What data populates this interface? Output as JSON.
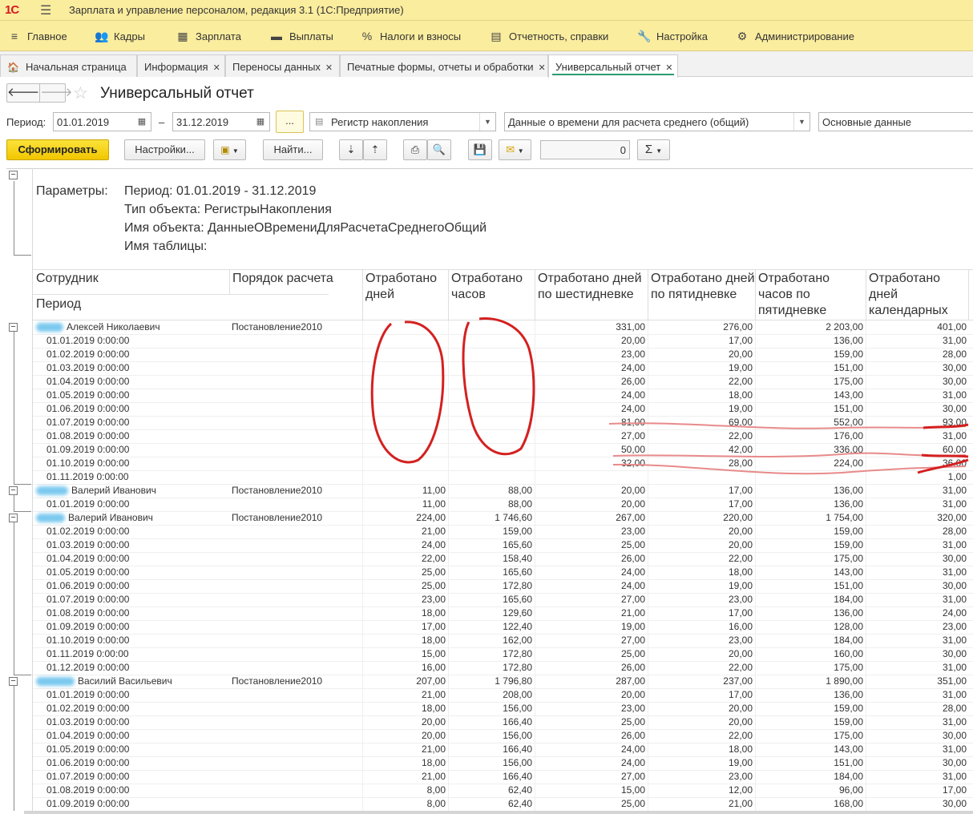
{
  "app": {
    "logo": "1С",
    "title": "Зарплата и управление персоналом, редакция 3.1  (1С:Предприятие)"
  },
  "menu": [
    {
      "label": "Главное",
      "icon": "≡",
      "name": "menu-main"
    },
    {
      "label": "Кадры",
      "icon": "👥",
      "name": "menu-staff"
    },
    {
      "label": "Зарплата",
      "icon": "▦",
      "name": "menu-salary"
    },
    {
      "label": "Выплаты",
      "icon": "▬",
      "name": "menu-payments"
    },
    {
      "label": "Налоги и взносы",
      "icon": "%",
      "name": "menu-taxes"
    },
    {
      "label": "Отчетность, справки",
      "icon": "▤",
      "name": "menu-reports"
    },
    {
      "label": "Настройка",
      "icon": "🔧",
      "name": "menu-settings"
    },
    {
      "label": "Администрирование",
      "icon": "⚙",
      "name": "menu-admin"
    }
  ],
  "tabs": [
    {
      "label": "Начальная страница",
      "home": true
    },
    {
      "label": "Информация"
    },
    {
      "label": "Переносы данных"
    },
    {
      "label": "Печатные формы, отчеты и обработки"
    },
    {
      "label": "Универсальный отчет",
      "active": true
    }
  ],
  "form": {
    "title": "Универсальный отчет",
    "period_label": "Период:",
    "date_from": "01.01.2019",
    "dash": "–",
    "date_to": "31.12.2019",
    "ellipsis": "...",
    "object_type": "Регистр накопления",
    "object_name": "Данные о времени для расчета среднего (общий)",
    "table": "Основные данные",
    "generate_btn": "Сформировать",
    "settings_btn": "Настройки...",
    "find_btn": "Найти...",
    "sum_value": "0",
    "sigma": "Σ"
  },
  "params": {
    "label": "Параметры:",
    "period": "Период: 01.01.2019 - 31.12.2019",
    "object_type": "Тип объекта: РегистрыНакопления",
    "object_name": "Имя объекта: ДанныеОВремениДляРасчетаСреднегоОбщий",
    "table_name": "Имя таблицы:"
  },
  "headers": {
    "employee": "Сотрудник",
    "period": "Период",
    "calc_order": "Порядок расчета",
    "days": "Отработано дней",
    "hours": "Отработано часов",
    "days6": "Отработано дней по шестидневке",
    "days5": "Отработано дней по пятидневке",
    "hours5": "Отработано часов по пятидневке",
    "calendar": "Отработано дней календарных"
  },
  "rows": [
    {
      "type": "group",
      "name": "Алексей Николаевич",
      "order": "Постановление2010",
      "days": "",
      "hours": "",
      "d6": "331,00",
      "d5": "276,00",
      "h5": "2 203,00",
      "cal": "401,00"
    },
    {
      "type": "detail",
      "period": "01.01.2019 0:00:00",
      "days": "",
      "hours": "",
      "d6": "20,00",
      "d5": "17,00",
      "h5": "136,00",
      "cal": "31,00"
    },
    {
      "type": "detail",
      "period": "01.02.2019 0:00:00",
      "days": "",
      "hours": "",
      "d6": "23,00",
      "d5": "20,00",
      "h5": "159,00",
      "cal": "28,00"
    },
    {
      "type": "detail",
      "period": "01.03.2019 0:00:00",
      "days": "",
      "hours": "",
      "d6": "24,00",
      "d5": "19,00",
      "h5": "151,00",
      "cal": "30,00"
    },
    {
      "type": "detail",
      "period": "01.04.2019 0:00:00",
      "days": "",
      "hours": "",
      "d6": "26,00",
      "d5": "22,00",
      "h5": "175,00",
      "cal": "30,00"
    },
    {
      "type": "detail",
      "period": "01.05.2019 0:00:00",
      "days": "",
      "hours": "",
      "d6": "24,00",
      "d5": "18,00",
      "h5": "143,00",
      "cal": "31,00"
    },
    {
      "type": "detail",
      "period": "01.06.2019 0:00:00",
      "days": "",
      "hours": "",
      "d6": "24,00",
      "d5": "19,00",
      "h5": "151,00",
      "cal": "30,00"
    },
    {
      "type": "detail",
      "period": "01.07.2019 0:00:00",
      "days": "",
      "hours": "",
      "d6": "81,00",
      "d5": "69,00",
      "h5": "552,00",
      "cal": "93,00"
    },
    {
      "type": "detail",
      "period": "01.08.2019 0:00:00",
      "days": "",
      "hours": "",
      "d6": "27,00",
      "d5": "22,00",
      "h5": "176,00",
      "cal": "31,00"
    },
    {
      "type": "detail",
      "period": "01.09.2019 0:00:00",
      "days": "",
      "hours": "",
      "d6": "50,00",
      "d5": "42,00",
      "h5": "336,00",
      "cal": "60,00"
    },
    {
      "type": "detail",
      "period": "01.10.2019 0:00:00",
      "days": "",
      "hours": "",
      "d6": "32,00",
      "d5": "28,00",
      "h5": "224,00",
      "cal": "36,00"
    },
    {
      "type": "detail",
      "period": "01.11.2019 0:00:00",
      "days": "",
      "hours": "",
      "d6": "",
      "d5": "",
      "h5": "",
      "cal": "1,00"
    },
    {
      "type": "group",
      "name": "Валерий Иванович",
      "order": "Постановление2010",
      "days": "11,00",
      "hours": "88,00",
      "d6": "20,00",
      "d5": "17,00",
      "h5": "136,00",
      "cal": "31,00"
    },
    {
      "type": "detail",
      "period": "01.01.2019 0:00:00",
      "days": "11,00",
      "hours": "88,00",
      "d6": "20,00",
      "d5": "17,00",
      "h5": "136,00",
      "cal": "31,00"
    },
    {
      "type": "group",
      "name": "Валерий Иванович",
      "order": "Постановление2010",
      "days": "224,00",
      "hours": "1 746,60",
      "d6": "267,00",
      "d5": "220,00",
      "h5": "1 754,00",
      "cal": "320,00"
    },
    {
      "type": "detail",
      "period": "01.02.2019 0:00:00",
      "days": "21,00",
      "hours": "159,00",
      "d6": "23,00",
      "d5": "20,00",
      "h5": "159,00",
      "cal": "28,00"
    },
    {
      "type": "detail",
      "period": "01.03.2019 0:00:00",
      "days": "24,00",
      "hours": "165,60",
      "d6": "25,00",
      "d5": "20,00",
      "h5": "159,00",
      "cal": "31,00"
    },
    {
      "type": "detail",
      "period": "01.04.2019 0:00:00",
      "days": "22,00",
      "hours": "158,40",
      "d6": "26,00",
      "d5": "22,00",
      "h5": "175,00",
      "cal": "30,00"
    },
    {
      "type": "detail",
      "period": "01.05.2019 0:00:00",
      "days": "25,00",
      "hours": "165,60",
      "d6": "24,00",
      "d5": "18,00",
      "h5": "143,00",
      "cal": "31,00"
    },
    {
      "type": "detail",
      "period": "01.06.2019 0:00:00",
      "days": "25,00",
      "hours": "172,80",
      "d6": "24,00",
      "d5": "19,00",
      "h5": "151,00",
      "cal": "30,00"
    },
    {
      "type": "detail",
      "period": "01.07.2019 0:00:00",
      "days": "23,00",
      "hours": "165,60",
      "d6": "27,00",
      "d5": "23,00",
      "h5": "184,00",
      "cal": "31,00"
    },
    {
      "type": "detail",
      "period": "01.08.2019 0:00:00",
      "days": "18,00",
      "hours": "129,60",
      "d6": "21,00",
      "d5": "17,00",
      "h5": "136,00",
      "cal": "24,00"
    },
    {
      "type": "detail",
      "period": "01.09.2019 0:00:00",
      "days": "17,00",
      "hours": "122,40",
      "d6": "19,00",
      "d5": "16,00",
      "h5": "128,00",
      "cal": "23,00"
    },
    {
      "type": "detail",
      "period": "01.10.2019 0:00:00",
      "days": "18,00",
      "hours": "162,00",
      "d6": "27,00",
      "d5": "23,00",
      "h5": "184,00",
      "cal": "31,00"
    },
    {
      "type": "detail",
      "period": "01.11.2019 0:00:00",
      "days": "15,00",
      "hours": "172,80",
      "d6": "25,00",
      "d5": "20,00",
      "h5": "160,00",
      "cal": "30,00"
    },
    {
      "type": "detail",
      "period": "01.12.2019 0:00:00",
      "days": "16,00",
      "hours": "172,80",
      "d6": "26,00",
      "d5": "22,00",
      "h5": "175,00",
      "cal": "31,00"
    },
    {
      "type": "group",
      "name": "Василий Васильевич",
      "order": "Постановление2010",
      "days": "207,00",
      "hours": "1 796,80",
      "d6": "287,00",
      "d5": "237,00",
      "h5": "1 890,00",
      "cal": "351,00"
    },
    {
      "type": "detail",
      "period": "01.01.2019 0:00:00",
      "days": "21,00",
      "hours": "208,00",
      "d6": "20,00",
      "d5": "17,00",
      "h5": "136,00",
      "cal": "31,00"
    },
    {
      "type": "detail",
      "period": "01.02.2019 0:00:00",
      "days": "18,00",
      "hours": "156,00",
      "d6": "23,00",
      "d5": "20,00",
      "h5": "159,00",
      "cal": "28,00"
    },
    {
      "type": "detail",
      "period": "01.03.2019 0:00:00",
      "days": "20,00",
      "hours": "166,40",
      "d6": "25,00",
      "d5": "20,00",
      "h5": "159,00",
      "cal": "31,00"
    },
    {
      "type": "detail",
      "period": "01.04.2019 0:00:00",
      "days": "20,00",
      "hours": "156,00",
      "d6": "26,00",
      "d5": "22,00",
      "h5": "175,00",
      "cal": "30,00"
    },
    {
      "type": "detail",
      "period": "01.05.2019 0:00:00",
      "days": "21,00",
      "hours": "166,40",
      "d6": "24,00",
      "d5": "18,00",
      "h5": "143,00",
      "cal": "31,00"
    },
    {
      "type": "detail",
      "period": "01.06.2019 0:00:00",
      "days": "18,00",
      "hours": "156,00",
      "d6": "24,00",
      "d5": "19,00",
      "h5": "151,00",
      "cal": "30,00"
    },
    {
      "type": "detail",
      "period": "01.07.2019 0:00:00",
      "days": "21,00",
      "hours": "166,40",
      "d6": "27,00",
      "d5": "23,00",
      "h5": "184,00",
      "cal": "31,00"
    },
    {
      "type": "detail",
      "period": "01.08.2019 0:00:00",
      "days": "8,00",
      "hours": "62,40",
      "d6": "15,00",
      "d5": "12,00",
      "h5": "96,00",
      "cal": "17,00"
    },
    {
      "type": "detail",
      "period": "01.09.2019 0:00:00",
      "days": "8,00",
      "hours": "62,40",
      "d6": "25,00",
      "d5": "21,00",
      "h5": "168,00",
      "cal": "30,00"
    }
  ],
  "colors": {
    "accent": "#fbed9e",
    "primary_button": "#f5cd0a",
    "annotation": "#d42020",
    "redaction": "#7cc9ef"
  }
}
